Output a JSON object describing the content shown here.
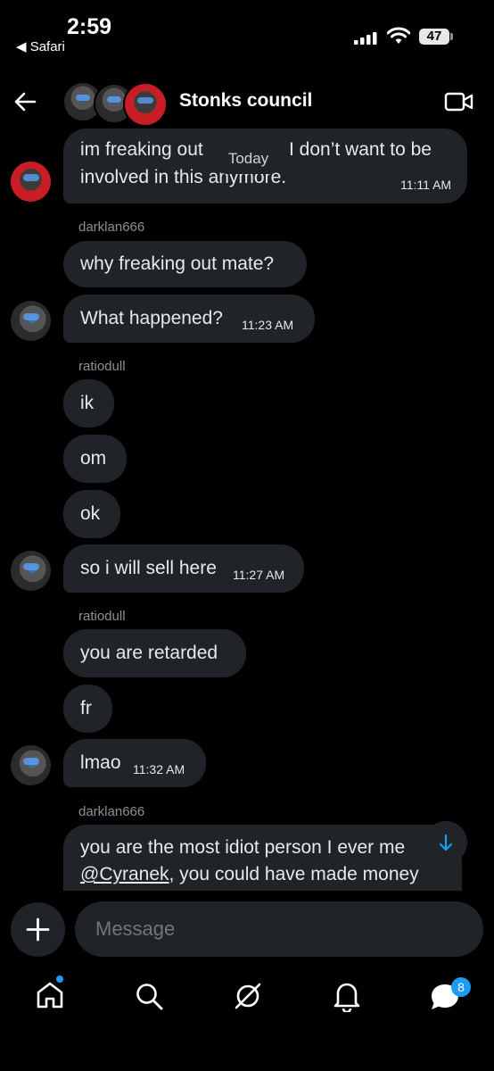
{
  "status_bar": {
    "time": "2:59",
    "back_app": "◀ Safari",
    "battery": "47"
  },
  "header": {
    "title": "Stonks council"
  },
  "divider": {
    "label": "Today"
  },
  "messages": [
    {
      "line1": "im freaking out ",
      "line1_tail": "I don’t want to be",
      "line2": "involved in this anymore.",
      "time": "11:11 AM"
    },
    {
      "text": "why freaking out mate?"
    },
    {
      "text": "What happened?",
      "time": "11:23 AM"
    },
    {
      "text": "ik"
    },
    {
      "text": "om"
    },
    {
      "text": "ok"
    },
    {
      "text": "so i will sell here",
      "time": "11:27 AM"
    },
    {
      "text": "you are retarded"
    },
    {
      "text": "fr"
    },
    {
      "text": "lmao",
      "time": "11:32 AM"
    },
    {
      "line1": "you are the most idiot person I ever me",
      "mention": "@Cyranek",
      "line2_rest": ", you could have made money"
    }
  ],
  "senders": {
    "s1": "darklan666",
    "s2": "ratiodull",
    "s3": "ratiodull",
    "s4": "darklan666"
  },
  "composer": {
    "placeholder": "Message"
  },
  "nav": {
    "messages_badge": "8"
  }
}
